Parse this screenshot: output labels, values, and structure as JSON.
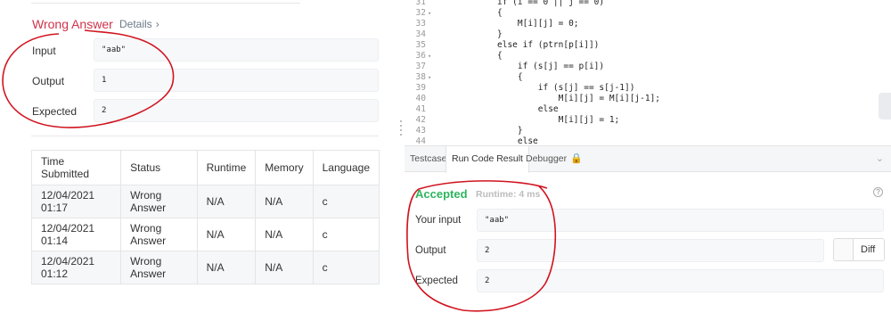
{
  "left": {
    "result_title": "Wrong Answer",
    "details_label": "Details",
    "details_chevron": "›",
    "io": [
      {
        "label": "Input",
        "value": "\"aab\""
      },
      {
        "label": "Output",
        "value": "1"
      },
      {
        "label": "Expected",
        "value": "2"
      }
    ],
    "table": {
      "headers": [
        "Time Submitted",
        "Status",
        "Runtime",
        "Memory",
        "Language"
      ],
      "rows": [
        [
          "12/04/2021 01:17",
          "Wrong Answer",
          "N/A",
          "N/A",
          "c"
        ],
        [
          "12/04/2021 01:14",
          "Wrong Answer",
          "N/A",
          "N/A",
          "c"
        ],
        [
          "12/04/2021 01:12",
          "Wrong Answer",
          "N/A",
          "N/A",
          "c"
        ]
      ]
    }
  },
  "editor": {
    "lines": [
      {
        "n": "31",
        "fold": "",
        "code": "if (i == 0 || j == 0)"
      },
      {
        "n": "32",
        "fold": "▾",
        "code": "{"
      },
      {
        "n": "33",
        "fold": "",
        "code": "    M[i][j] = 0;"
      },
      {
        "n": "34",
        "fold": "",
        "code": "}"
      },
      {
        "n": "35",
        "fold": "",
        "code": "else if (ptrn[p[i]])"
      },
      {
        "n": "36",
        "fold": "▾",
        "code": "{"
      },
      {
        "n": "37",
        "fold": "",
        "code": "    if (s[j] == p[i])"
      },
      {
        "n": "38",
        "fold": "▾",
        "code": "    {"
      },
      {
        "n": "39",
        "fold": "",
        "code": "        if (s[j] == s[j-1])"
      },
      {
        "n": "40",
        "fold": "",
        "code": "            M[i][j] = M[i][j-1];"
      },
      {
        "n": "41",
        "fold": "",
        "code": "        else"
      },
      {
        "n": "42",
        "fold": "",
        "code": "            M[i][j] = 1;"
      },
      {
        "n": "43",
        "fold": "",
        "code": "    }"
      },
      {
        "n": "44",
        "fold": "",
        "code": "    else"
      }
    ]
  },
  "tabs": {
    "testcase": "Testcase",
    "run_code_result": "Run Code Result",
    "debugger": "Debugger",
    "lock_icon": "🔒",
    "collapse_icon": "⌄"
  },
  "result": {
    "status": "Accepted",
    "runtime": "Runtime: 4 ms",
    "help_icon": "?",
    "your_input_label": "Your input",
    "your_input": "\"aab\"",
    "output_label": "Output",
    "output": "2",
    "expected_label": "Expected",
    "expected": "2",
    "diff_label": "Diff"
  },
  "colors": {
    "wrong": "#d0334b",
    "accepted": "#2db55d",
    "annotation": "#d1141f"
  }
}
